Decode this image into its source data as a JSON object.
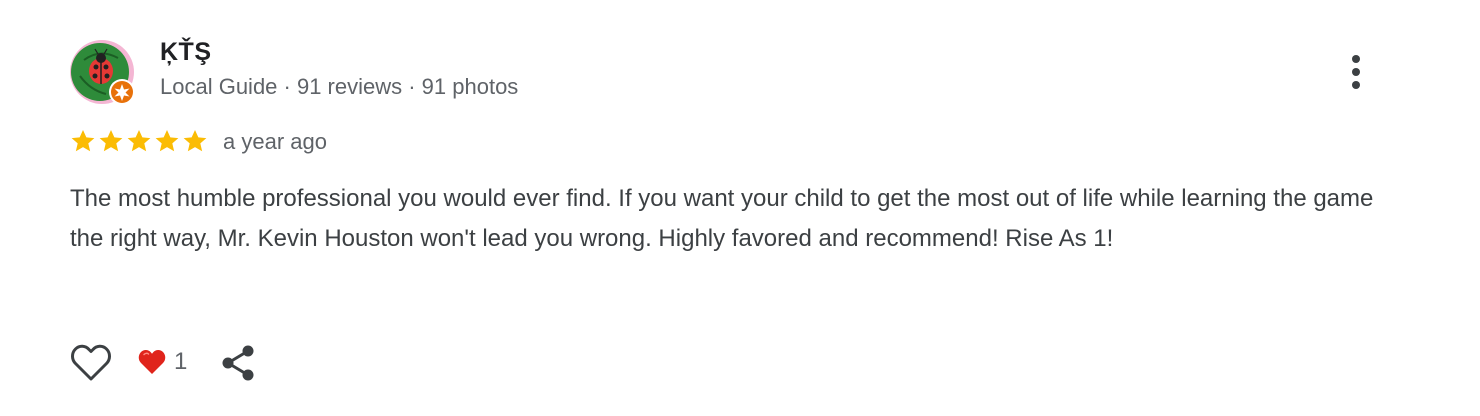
{
  "author": {
    "name": "ĶŤŞ",
    "meta": "Local Guide · 91 reviews · 91 photos",
    "avatar_icon": "ladybug-avatar-icon",
    "badge_icon": "local-guide-badge-icon"
  },
  "review": {
    "rating": 5,
    "rating_max": 5,
    "date": "a year ago",
    "text": "The most humble professional you would ever find. If you want your child to get the most out of life while learning the game the right way, Mr. Kevin Houston won't lead you wrong. Highly favored and recommend! Rise As 1!"
  },
  "actions": {
    "like_icon": "heart-outline-icon",
    "reaction_icon": "red-heart-icon",
    "reaction_count": "1",
    "share_icon": "share-icon",
    "more_icon": "more-vert-icon"
  },
  "colors": {
    "star": "#fbbc04",
    "text": "#3c4043",
    "secondary": "#5f6368",
    "badge": "#e8710a",
    "avatar_bg": "#2e8b3a"
  }
}
